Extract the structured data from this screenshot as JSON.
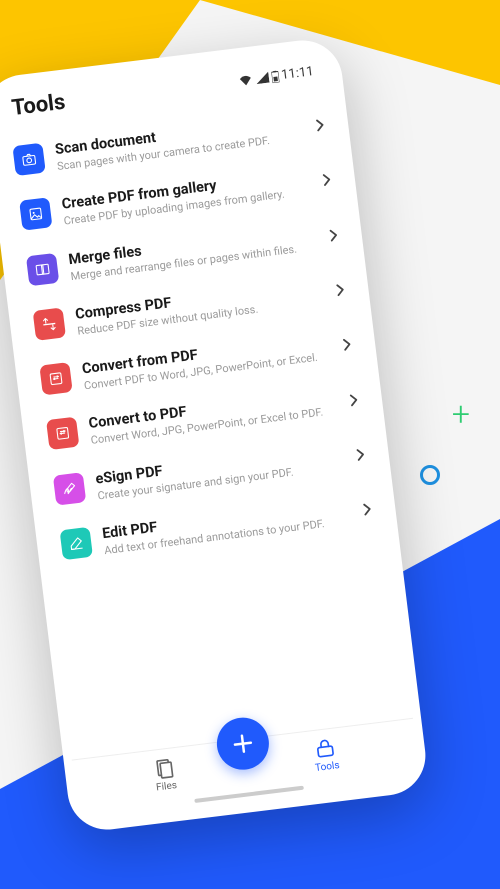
{
  "header": {
    "title": "Tools",
    "time": "11:11"
  },
  "tools": [
    {
      "title": "Scan document",
      "desc": "Scan pages with your camera to create PDF.",
      "color": "#205AFC",
      "icon": "camera"
    },
    {
      "title": "Create PDF from gallery",
      "desc": "Create PDF by uploading images from gallery.",
      "color": "#205AFC",
      "icon": "image"
    },
    {
      "title": "Merge files",
      "desc": "Merge and rearrange files or pages within files.",
      "color": "#6A4FE8",
      "icon": "merge"
    },
    {
      "title": "Compress PDF",
      "desc": "Reduce PDF size without quality loss.",
      "color": "#E84C4C",
      "icon": "compress"
    },
    {
      "title": "Convert from PDF",
      "desc": "Convert PDF to Word, JPG, PowerPoint, or Excel.",
      "color": "#E84C4C",
      "icon": "convert"
    },
    {
      "title": "Convert to PDF",
      "desc": "Convert Word, JPG, PowerPoint, or Excel to PDF.",
      "color": "#E84C4C",
      "icon": "convert"
    },
    {
      "title": "eSign PDF",
      "desc": "Create your signature and sign your PDF.",
      "color": "#D64FE8",
      "icon": "sign"
    },
    {
      "title": "Edit PDF",
      "desc": "Add text or freehand annotations to your PDF.",
      "color": "#1EC9B7",
      "icon": "edit"
    }
  ],
  "nav": {
    "files": "Files",
    "tools": "Tools"
  }
}
